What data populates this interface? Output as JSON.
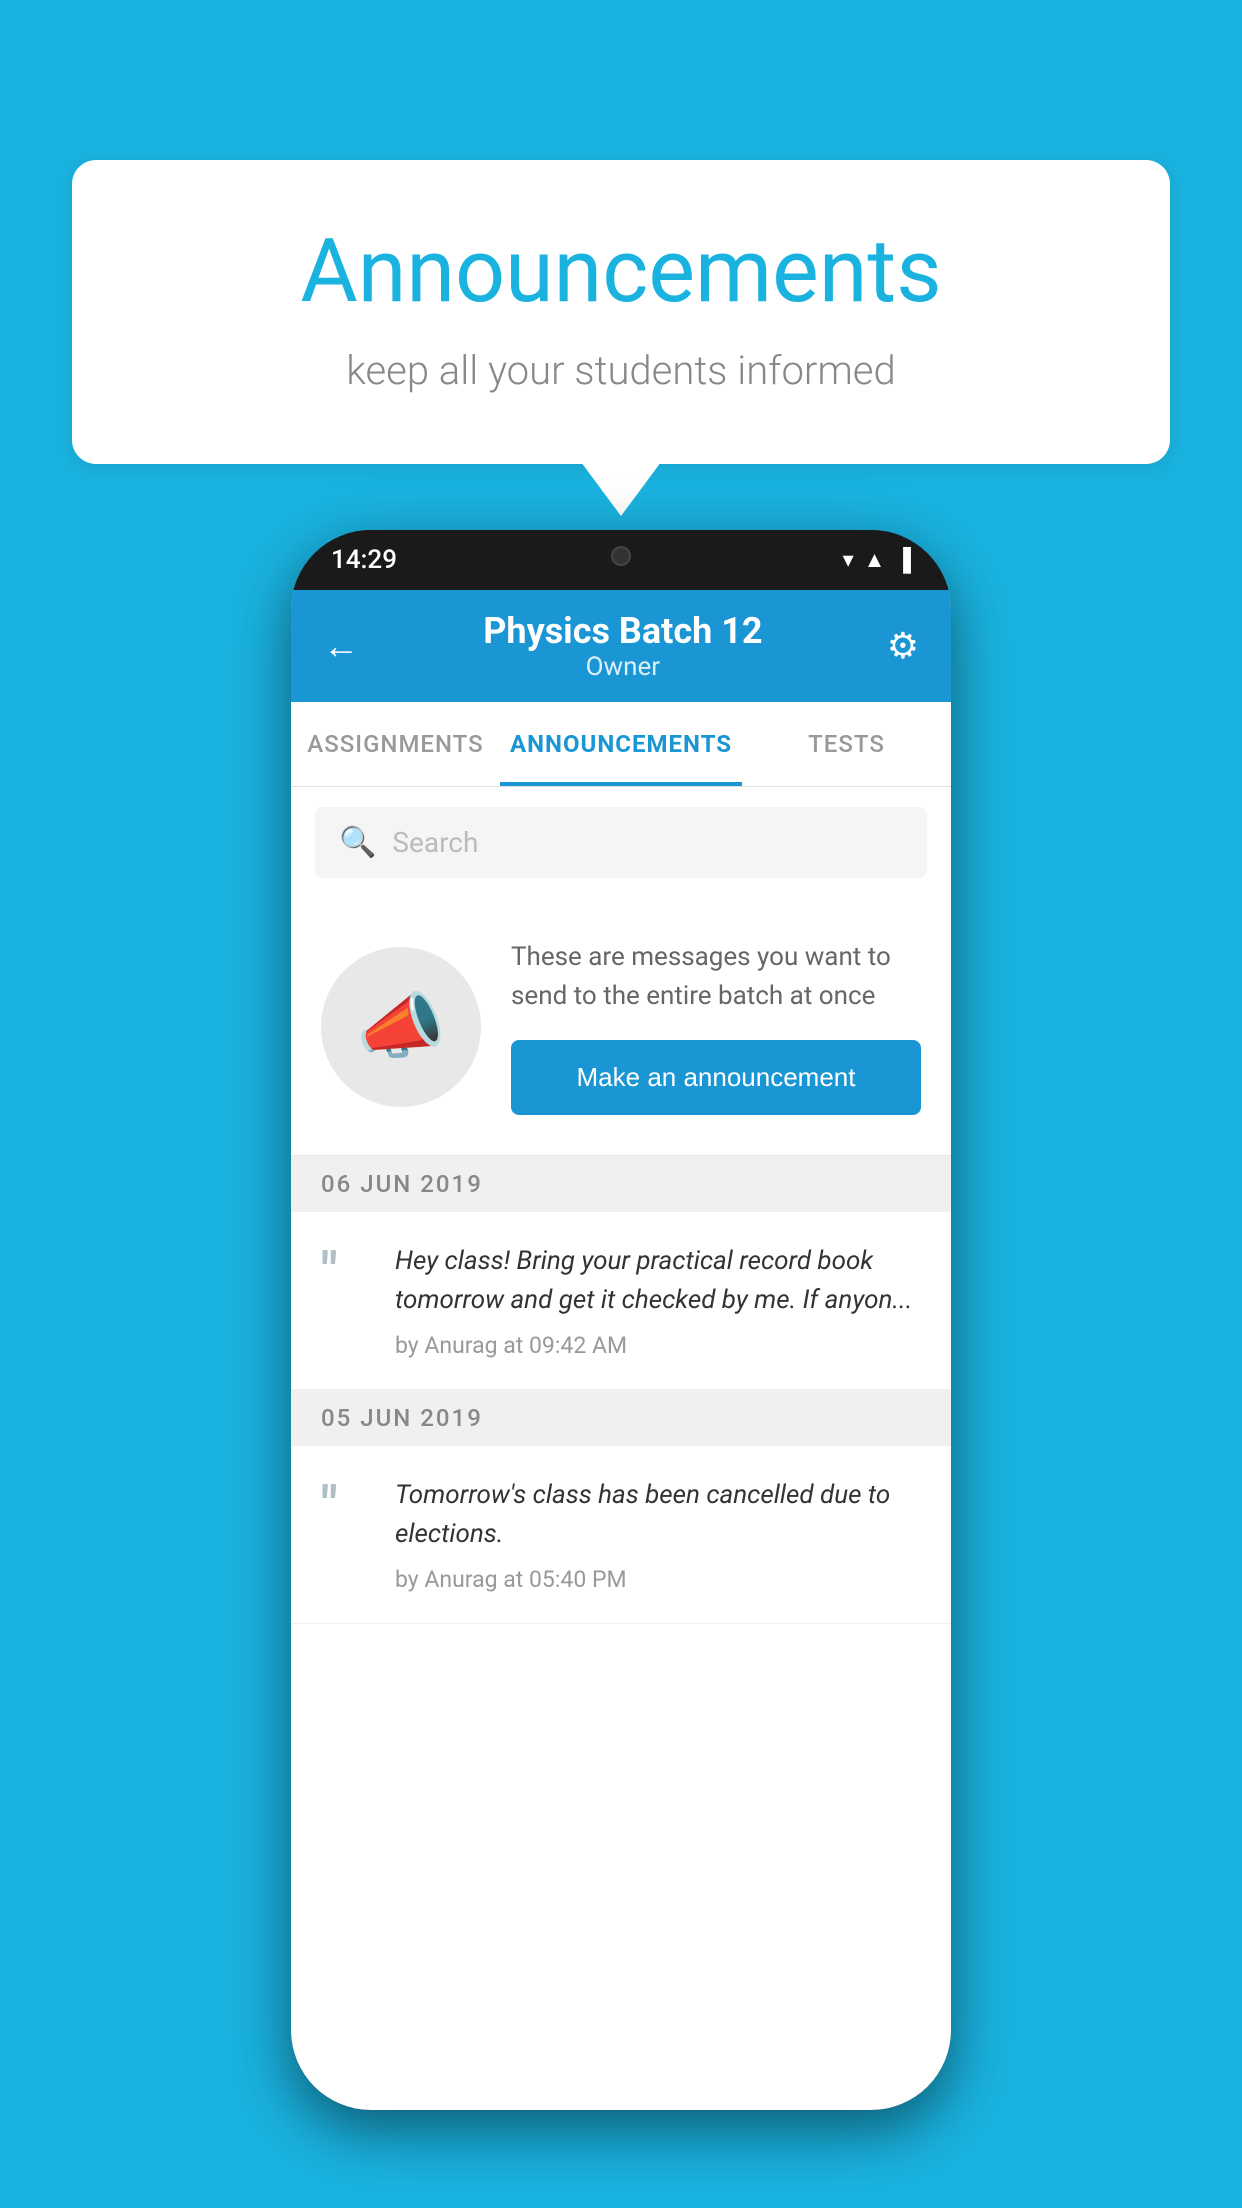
{
  "background_color": "#1ab3e0",
  "speech_bubble": {
    "title": "Announcements",
    "subtitle": "keep all your students informed"
  },
  "phone": {
    "status_bar": {
      "time": "14:29"
    },
    "header": {
      "title": "Physics Batch 12",
      "subtitle": "Owner",
      "back_label": "←",
      "settings_label": "⚙"
    },
    "tabs": [
      {
        "label": "ASSIGNMENTS",
        "active": false
      },
      {
        "label": "ANNOUNCEMENTS",
        "active": true
      },
      {
        "label": "TESTS",
        "active": false
      }
    ],
    "search": {
      "placeholder": "Search"
    },
    "announcement_prompt": {
      "description": "These are messages you want to send to the entire batch at once",
      "button_label": "Make an announcement"
    },
    "announcements": [
      {
        "date": "06  JUN  2019",
        "text": "Hey class! Bring your practical record book tomorrow and get it checked by me. If anyon...",
        "meta": "by Anurag at 09:42 AM"
      },
      {
        "date": "05  JUN  2019",
        "text": "Tomorrow's class has been cancelled due to elections.",
        "meta": "by Anurag at 05:40 PM"
      }
    ]
  }
}
